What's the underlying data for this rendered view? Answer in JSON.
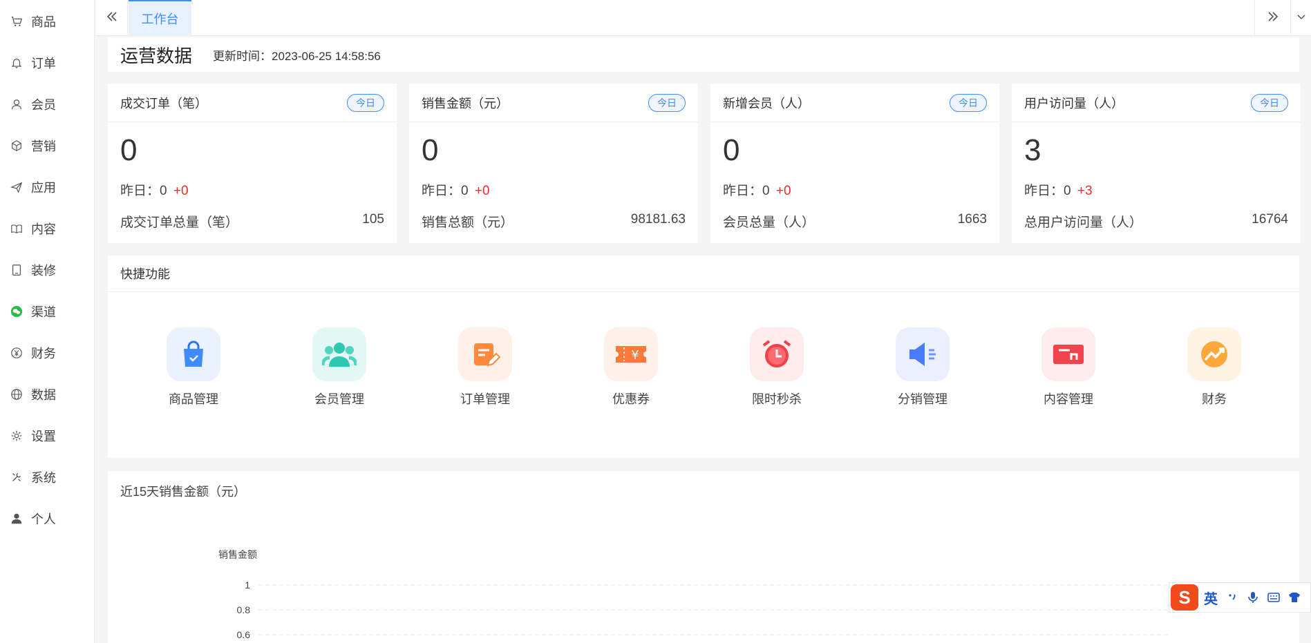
{
  "sidebar": {
    "items": [
      {
        "label": "商品",
        "icon": "cart-icon"
      },
      {
        "label": "订单",
        "icon": "bell-icon"
      },
      {
        "label": "会员",
        "icon": "user-icon"
      },
      {
        "label": "营销",
        "icon": "cube-icon"
      },
      {
        "label": "应用",
        "icon": "send-icon"
      },
      {
        "label": "内容",
        "icon": "book-icon"
      },
      {
        "label": "装修",
        "icon": "tablet-icon"
      },
      {
        "label": "渠道",
        "icon": "wechat-icon"
      },
      {
        "label": "财务",
        "icon": "yen-icon"
      },
      {
        "label": "数据",
        "icon": "globe-icon"
      },
      {
        "label": "设置",
        "icon": "gear-icon"
      },
      {
        "label": "系统",
        "icon": "tools-icon"
      },
      {
        "label": "个人",
        "icon": "person-icon"
      }
    ]
  },
  "tabs": {
    "active_label": "工作台"
  },
  "ops": {
    "title": "运营数据",
    "update_label": "更新时间：",
    "update_time": "2023-06-25 14:58:56"
  },
  "cards": [
    {
      "title": "成交订单（笔）",
      "badge": "今日",
      "value": "0",
      "yest_label": "昨日：",
      "yest_value": "0",
      "yest_delta": "+0",
      "total_label": "成交订单总量（笔）",
      "total_value": "105"
    },
    {
      "title": "销售金额（元）",
      "badge": "今日",
      "value": "0",
      "yest_label": "昨日：",
      "yest_value": "0",
      "yest_delta": "+0",
      "total_label": "销售总额（元）",
      "total_value": "98181.63"
    },
    {
      "title": "新增会员（人）",
      "badge": "今日",
      "value": "0",
      "yest_label": "昨日：",
      "yest_value": "0",
      "yest_delta": "+0",
      "total_label": "会员总量（人）",
      "total_value": "1663"
    },
    {
      "title": "用户访问量（人）",
      "badge": "今日",
      "value": "3",
      "yest_label": "昨日：",
      "yest_value": "0",
      "yest_delta": "+3",
      "total_label": "总用户访问量（人）",
      "total_value": "16764"
    }
  ],
  "quick": {
    "title": "快捷功能",
    "items": [
      {
        "label": "商品管理",
        "icon": "shopping-bag-icon",
        "bg": "#eaf2ff",
        "color": "#3f8cff"
      },
      {
        "label": "会员管理",
        "icon": "members-icon",
        "bg": "#e3f8f5",
        "color": "#2ec7b0"
      },
      {
        "label": "订单管理",
        "icon": "order-edit-icon",
        "bg": "#fff1e8",
        "color": "#ff8a3d"
      },
      {
        "label": "优惠券",
        "icon": "coupon-icon",
        "bg": "#fff1e8",
        "color": "#ff7a3a"
      },
      {
        "label": "限时秒杀",
        "icon": "alarm-clock-icon",
        "bg": "#ffecec",
        "color": "#f0404a"
      },
      {
        "label": "分销管理",
        "icon": "megaphone-icon",
        "bg": "#eaf0ff",
        "color": "#4a7bff"
      },
      {
        "label": "内容管理",
        "icon": "content-card-icon",
        "bg": "#ffecee",
        "color": "#f0434c"
      },
      {
        "label": "财务",
        "icon": "finance-trend-icon",
        "bg": "#fff3e3",
        "color": "#ffa83a"
      }
    ]
  },
  "chart_data": {
    "type": "line",
    "title": "近15天销售金额（元）",
    "ylabel": "销售金额",
    "yticks": [
      "1",
      "0.8",
      "0.6"
    ],
    "ylim": [
      0,
      1
    ],
    "grid": true,
    "series": []
  },
  "ime": {
    "logo": "S",
    "lang": "英"
  }
}
